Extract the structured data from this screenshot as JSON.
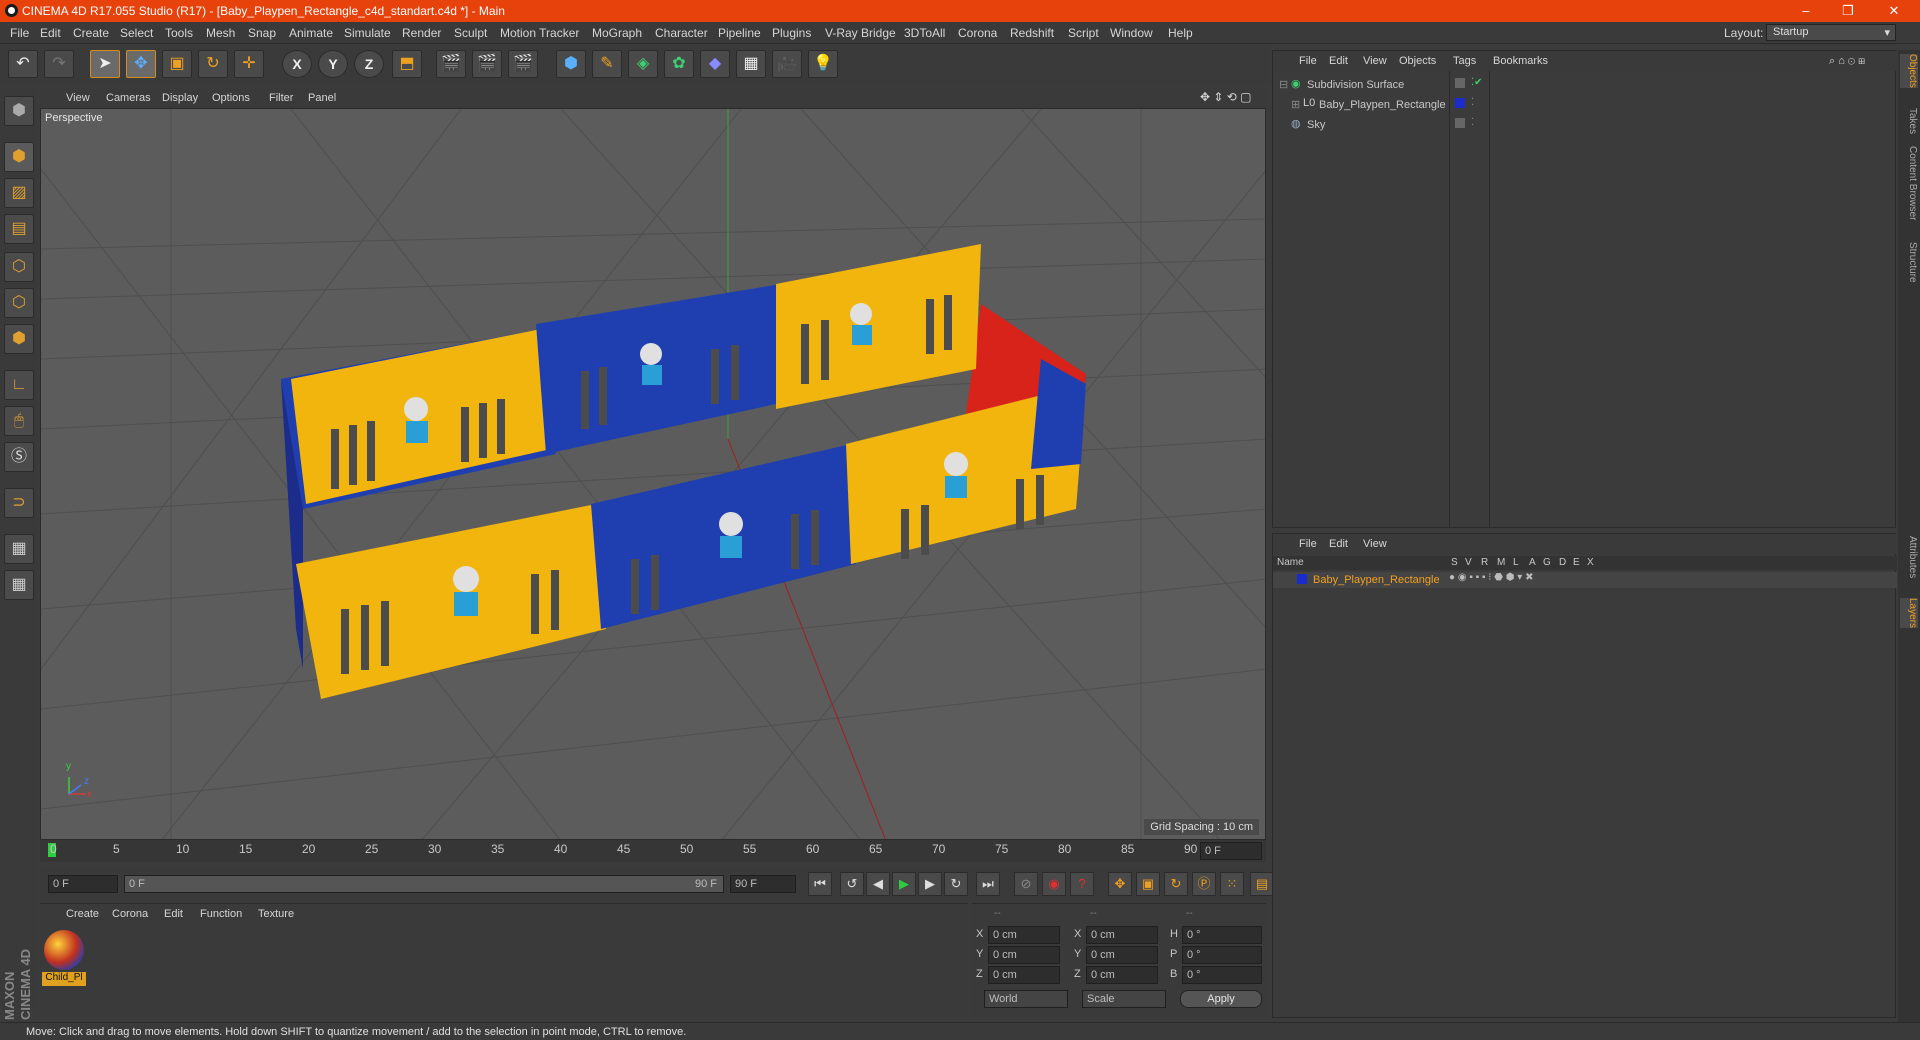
{
  "window": {
    "title": "CINEMA 4D R17.055 Studio (R17) - [Baby_Playpen_Rectangle_c4d_standart.c4d *] - Main",
    "minimize": "–",
    "maximize": "❐",
    "close": "✕"
  },
  "menu": [
    "File",
    "Edit",
    "Create",
    "Select",
    "Tools",
    "Mesh",
    "Snap",
    "Animate",
    "Simulate",
    "Render",
    "Sculpt",
    "Motion Tracker",
    "MoGraph",
    "Character",
    "Pipeline",
    "Plugins",
    "V-Ray Bridge",
    "3DToAll",
    "Corona",
    "Redshift",
    "Script",
    "Window",
    "Help"
  ],
  "layout": {
    "label": "Layout:",
    "value": "Startup"
  },
  "toolbar": {
    "undo_icon": "undo-icon",
    "redo_icon": "redo-icon",
    "axis_x": "X",
    "axis_y": "Y",
    "axis_z": "Z"
  },
  "viewport": {
    "menu": [
      "View",
      "Cameras",
      "Display",
      "Options",
      "Filter",
      "Panel"
    ],
    "camera_label": "Perspective",
    "grid_spacing": "Grid Spacing : 10 cm",
    "axis_y": "y",
    "axis_x": "x",
    "axis_z": "z"
  },
  "timeline": {
    "ticks": [
      "0",
      "5",
      "10",
      "15",
      "20",
      "25",
      "30",
      "35",
      "40",
      "45",
      "50",
      "55",
      "60",
      "65",
      "70",
      "75",
      "80",
      "85",
      "90"
    ],
    "current_frame_field": "0 F",
    "start_field": "0 F",
    "range_start": "0 F",
    "range_end": "90 F",
    "end_field": "90 F"
  },
  "material_manager": {
    "menu": [
      "Create",
      "Corona",
      "Edit",
      "Function",
      "Texture"
    ],
    "materials": [
      {
        "name": "Child_Pl"
      }
    ]
  },
  "coordinates": {
    "header": [
      "--",
      "--",
      "--"
    ],
    "rows": [
      {
        "a": "X",
        "av": "0 cm",
        "b": "X",
        "bv": "0 cm",
        "c": "H",
        "cv": "0 °"
      },
      {
        "a": "Y",
        "av": "0 cm",
        "b": "Y",
        "bv": "0 cm",
        "c": "P",
        "cv": "0 °"
      },
      {
        "a": "Z",
        "av": "0 cm",
        "b": "Z",
        "bv": "0 cm",
        "c": "B",
        "cv": "0 °"
      }
    ],
    "mode": "World",
    "scale": "Scale",
    "apply": "Apply"
  },
  "object_manager": {
    "menu": [
      "File",
      "Edit",
      "View",
      "Objects",
      "Tags",
      "Bookmarks"
    ],
    "objects": [
      {
        "name": "Subdivision Surface"
      },
      {
        "name": "Baby_Playpen_Rectangle"
      },
      {
        "name": "Sky"
      }
    ]
  },
  "layer_manager": {
    "menu": [
      "File",
      "Edit",
      "View"
    ],
    "columns": [
      "Name",
      "S",
      "V",
      "R",
      "M",
      "L",
      "A",
      "G",
      "D",
      "E",
      "X"
    ],
    "layers": [
      {
        "name": "Baby_Playpen_Rectangle",
        "color": "#1a2ccc"
      }
    ]
  },
  "right_tabs": [
    "Objects",
    "Takes",
    "Content Browser",
    "Structure",
    "Attributes",
    "Layers"
  ],
  "brand": {
    "line1": "MAXON",
    "line2": "CINEMA 4D"
  },
  "status": "Move: Click and drag to move elements. Hold down SHIFT to quantize movement / add to the selection in point mode, CTRL to remove.",
  "colors": {
    "accent": "#e8420c",
    "panel_yellow": "#f2b50d",
    "panel_blue": "#1f3fb0",
    "panel_red": "#d8231a"
  }
}
